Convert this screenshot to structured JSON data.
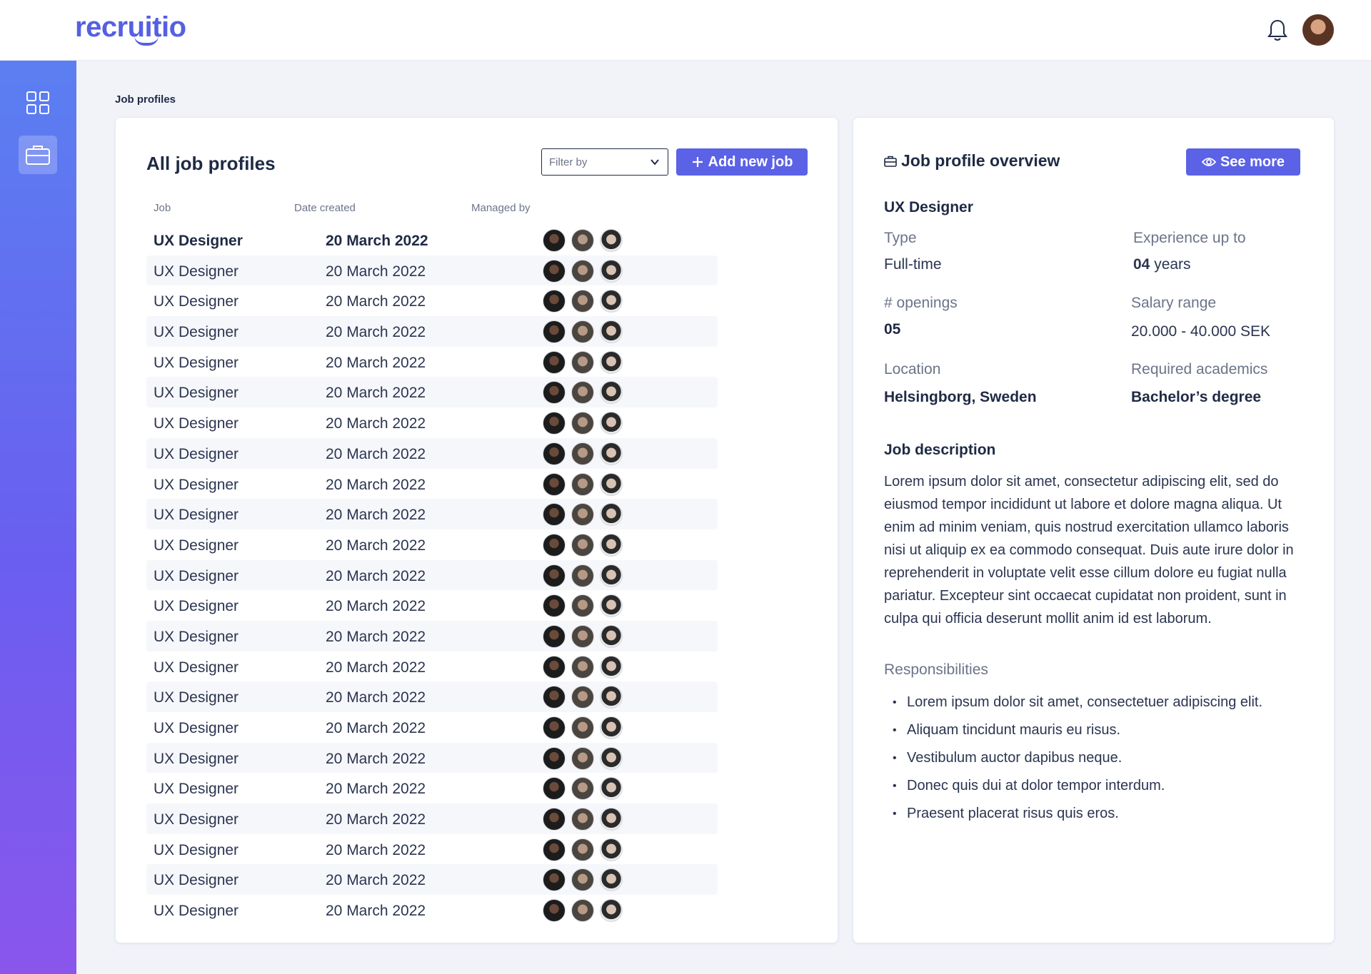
{
  "app": {
    "logo": "recruitio"
  },
  "breadcrumb": "Job profiles",
  "list": {
    "title": "All job profiles",
    "filter_placeholder": "Filter by",
    "add_button": "Add new job",
    "columns": [
      "Job",
      "Date created",
      "Managed by"
    ],
    "rows": [
      {
        "job": "UX Designer",
        "date": "20 March 2022"
      },
      {
        "job": "UX Designer",
        "date": "20 March 2022"
      },
      {
        "job": "UX Designer",
        "date": "20 March 2022"
      },
      {
        "job": "UX Designer",
        "date": "20 March 2022"
      },
      {
        "job": "UX Designer",
        "date": "20 March 2022"
      },
      {
        "job": "UX Designer",
        "date": "20 March 2022"
      },
      {
        "job": "UX Designer",
        "date": "20 March 2022"
      },
      {
        "job": "UX Designer",
        "date": "20 March 2022"
      },
      {
        "job": "UX Designer",
        "date": "20 March 2022"
      },
      {
        "job": "UX Designer",
        "date": "20 March 2022"
      },
      {
        "job": "UX Designer",
        "date": "20 March 2022"
      },
      {
        "job": "UX Designer",
        "date": "20 March 2022"
      },
      {
        "job": "UX Designer",
        "date": "20 March 2022"
      },
      {
        "job": "UX Designer",
        "date": "20 March 2022"
      },
      {
        "job": "UX Designer",
        "date": "20 March 2022"
      },
      {
        "job": "UX Designer",
        "date": "20 March 2022"
      },
      {
        "job": "UX Designer",
        "date": "20 March 2022"
      },
      {
        "job": "UX Designer",
        "date": "20 March 2022"
      },
      {
        "job": "UX Designer",
        "date": "20 March 2022"
      },
      {
        "job": "UX Designer",
        "date": "20 March 2022"
      },
      {
        "job": "UX Designer",
        "date": "20 March 2022"
      },
      {
        "job": "UX Designer",
        "date": "20 March 2022"
      },
      {
        "job": "UX Designer",
        "date": "20 March 2022"
      }
    ]
  },
  "overview": {
    "title": "Job profile overview",
    "see_more": "See more",
    "job_title": "UX Designer",
    "type_label": "Type",
    "type_value": "Full-time",
    "experience_label": "Experience up to",
    "experience_value": "04",
    "experience_unit": "years",
    "openings_label": "# openings",
    "openings_value": "05",
    "salary_label": "Salary range",
    "salary_value": "20.000 - 40.000 SEK",
    "location_label": "Location",
    "location_value": "Helsingborg, Sweden",
    "academics_label": "Required academics",
    "academics_value": "Bachelor’s degree",
    "description_heading": "Job description",
    "description": "Lorem ipsum dolor sit amet, consectetur adipiscing elit, sed do eiusmod tempor incididunt ut labore et dolore magna aliqua. Ut enim ad minim veniam, quis nostrud exercitation ullamco laboris nisi ut aliquip ex ea commodo consequat. Duis aute irure dolor in reprehenderit in voluptate velit esse cillum dolore eu fugiat nulla pariatur. Excepteur sint occaecat cupidatat non proident, sunt in culpa qui officia deserunt mollit anim id est laborum.",
    "responsibilities_heading": "Responsibilities",
    "responsibilities": [
      "Lorem ipsum dolor sit amet, consectetuer adipiscing elit.",
      "Aliquam tincidunt mauris eu risus.",
      "Vestibulum auctor dapibus neque.",
      "Donec quis dui at dolor tempor interdum.",
      "Praesent placerat risus quis eros."
    ]
  },
  "icons": {
    "sidebar": [
      "dashboard-icon",
      "briefcase-icon"
    ],
    "topbar": [
      "bell-icon"
    ]
  },
  "colors": {
    "accent": "#5b62e6",
    "brand": "#5560e0",
    "sidebar_top": "#5b7ff1",
    "sidebar_bottom": "#8a56ec"
  }
}
